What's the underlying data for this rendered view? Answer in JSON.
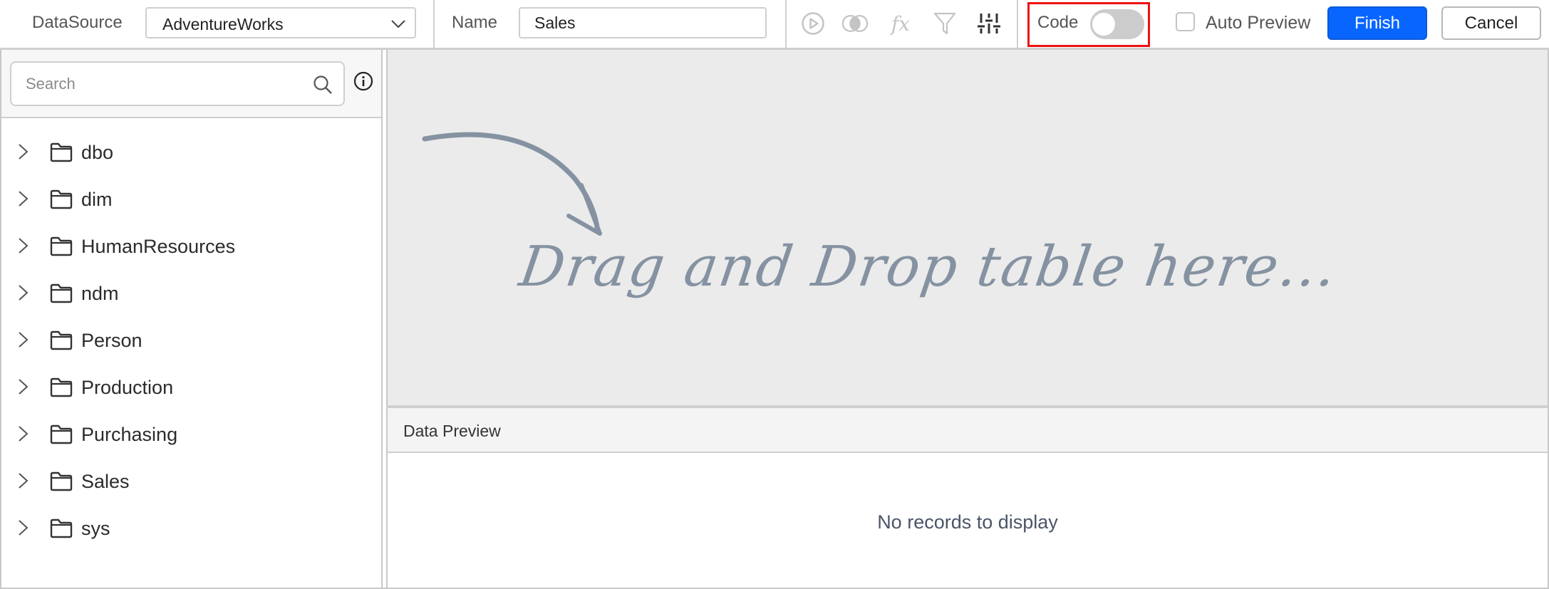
{
  "header": {
    "datasource_label": "DataSource",
    "datasource_value": "AdventureWorks",
    "name_label": "Name",
    "name_value": "Sales",
    "toolbar_icons": [
      {
        "name": "run-query-icon",
        "enabled": false
      },
      {
        "name": "join-icon",
        "enabled": false
      },
      {
        "name": "expression-icon",
        "label": "fx",
        "enabled": false
      },
      {
        "name": "filter-icon",
        "enabled": false
      },
      {
        "name": "settings-sliders-icon",
        "enabled": true
      }
    ],
    "code_label": "Code",
    "code_toggle_on": false,
    "auto_preview_label": "Auto Preview",
    "auto_preview_checked": false,
    "finish_label": "Finish",
    "cancel_label": "Cancel"
  },
  "colors": {
    "primary": "#0866ff",
    "highlight": "#ee1111",
    "drop_text": "#8592a1"
  },
  "left_panel": {
    "search_placeholder": "Search",
    "tree": [
      {
        "label": "dbo"
      },
      {
        "label": "dim"
      },
      {
        "label": "HumanResources"
      },
      {
        "label": "ndm"
      },
      {
        "label": "Person"
      },
      {
        "label": "Production"
      },
      {
        "label": "Purchasing"
      },
      {
        "label": "Sales"
      },
      {
        "label": "sys"
      }
    ]
  },
  "canvas": {
    "drop_hint": "Drag and Drop table here..."
  },
  "preview": {
    "title": "Data Preview",
    "empty_message": "No records to display"
  }
}
